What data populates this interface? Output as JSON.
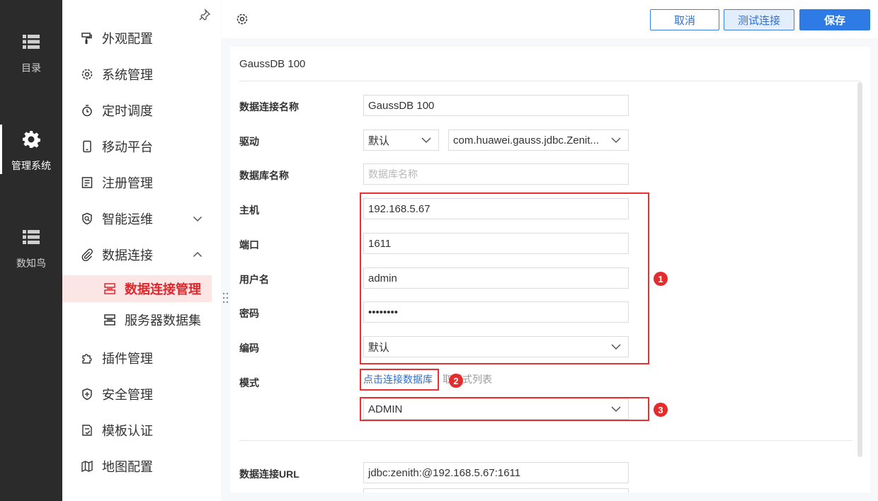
{
  "rail": {
    "items": [
      {
        "label": "目录",
        "icon": "list-icon"
      },
      {
        "label": "管理系统",
        "icon": "gear-icon",
        "active": true
      },
      {
        "label": "数知鸟",
        "icon": "list-icon"
      }
    ]
  },
  "menu": {
    "items": [
      {
        "label": "外观配置",
        "icon": "paint-roller-icon"
      },
      {
        "label": "系统管理",
        "icon": "gear-icon"
      },
      {
        "label": "定时调度",
        "icon": "stopwatch-icon"
      },
      {
        "label": "移动平台",
        "icon": "mobile-icon"
      },
      {
        "label": "注册管理",
        "icon": "register-icon"
      },
      {
        "label": "智能运维",
        "icon": "shield-search-icon",
        "expandable": "collapsed"
      },
      {
        "label": "数据连接",
        "icon": "paperclip-icon",
        "expandable": "expanded"
      },
      {
        "label": "数据连接管理",
        "icon": "database-icon",
        "sub": true,
        "selected": true
      },
      {
        "label": "服务器数据集",
        "icon": "server-dataset-icon",
        "sub": true
      },
      {
        "label": "插件管理",
        "icon": "puzzle-icon"
      },
      {
        "label": "安全管理",
        "icon": "shield-plus-icon"
      },
      {
        "label": "模板认证",
        "icon": "document-certify-icon"
      },
      {
        "label": "地图配置",
        "icon": "map-icon"
      }
    ]
  },
  "toolbar": {
    "cancel_label": "取消",
    "test_label": "测试连接",
    "save_label": "保存"
  },
  "form": {
    "title": "GaussDB 100",
    "name_label": "数据连接名称",
    "name_value": "GaussDB 100",
    "driver_label": "驱动",
    "driver_mode": "默认",
    "driver_class": "com.huawei.gauss.jdbc.Zenit...",
    "dbname_label": "数据库名称",
    "dbname_placeholder": "数据库名称",
    "host_label": "主机",
    "host_value": "192.168.5.67",
    "port_label": "端口",
    "port_value": "1611",
    "user_label": "用户名",
    "user_value": "admin",
    "password_label": "密码",
    "password_value": "••••••••",
    "encoding_label": "编码",
    "encoding_value": "默认",
    "schema_label": "模式",
    "connect_link": "点击连接数据库",
    "schema_hint": "取模式列表",
    "schema_value": "ADMIN",
    "url_label": "数据连接URL",
    "url_value": "jdbc:zenith:@192.168.5.67:1611"
  },
  "badges": [
    "1",
    "2",
    "3"
  ],
  "colors": {
    "rail_bg": "#2b2b2b",
    "accent_red": "#e0262b",
    "primary_blue": "#2f7be5",
    "annotation_red": "#e53333"
  }
}
